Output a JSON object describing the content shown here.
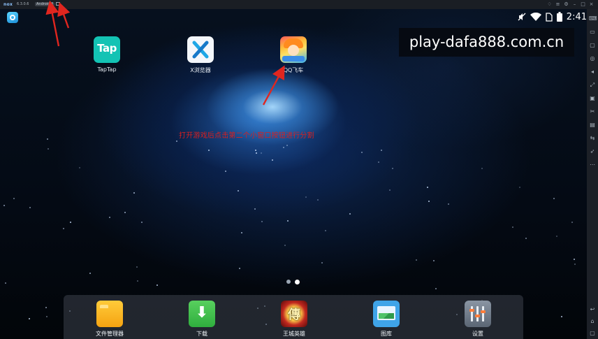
{
  "titlebar": {
    "logo": "nox",
    "version": "6.3.0.6",
    "android_badge": "Android 4"
  },
  "statusbar": {
    "time": "2:41",
    "icons": [
      "mute-icon",
      "wifi-icon",
      "sim-icon",
      "battery-icon"
    ]
  },
  "watermark": "play-dafa888.com.cn",
  "annotation": "打开游戏后点击第二个小窗口按钮进行分割",
  "desktop_apps": [
    {
      "label": "TapTap",
      "icon": "taptap-icon",
      "icon_text": "Tap"
    },
    {
      "label": "X浏览器",
      "icon": "x-browser-icon"
    },
    {
      "label": "QQ飞车",
      "icon": "qq-speed-icon"
    }
  ],
  "pager": {
    "pages": 2,
    "active": 2
  },
  "dock": [
    {
      "label": "文件管理器",
      "icon": "folder-icon"
    },
    {
      "label": "下载",
      "icon": "download-icon",
      "glyph": "⬇"
    },
    {
      "label": "王城英雄",
      "icon": "wangcheng-hero-icon",
      "glyph": "傳"
    },
    {
      "label": "图库",
      "icon": "gallery-icon"
    },
    {
      "label": "设置",
      "icon": "settings-icon"
    }
  ],
  "sidebar_icons": [
    "keyboard-icon",
    "screen-icon",
    "message-icon",
    "location-icon",
    "volume-icon",
    "fullscreen-icon",
    "record-icon",
    "scissors-icon",
    "folder-icon",
    "shake-icon",
    "rocket-icon",
    "more-icon",
    "back-icon",
    "home-icon",
    "recent-apps-icon"
  ],
  "colors": {
    "annotation": "#d91f1f",
    "arrows": "#e0261f",
    "taptap": "#13c3b4"
  }
}
